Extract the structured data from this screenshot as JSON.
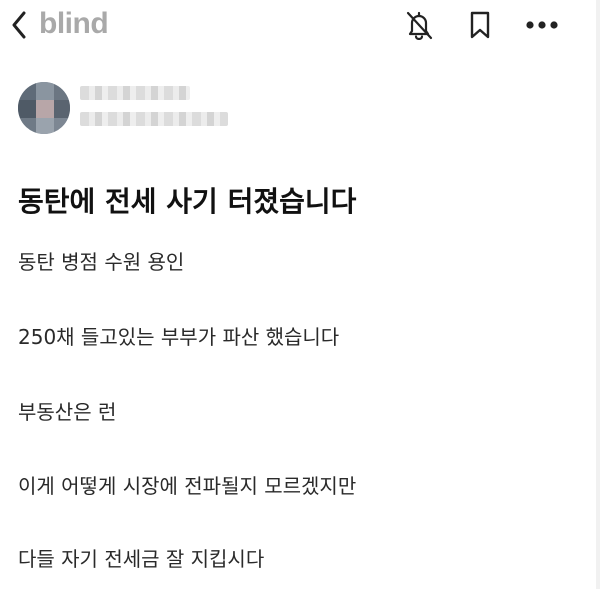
{
  "header": {
    "brand": "blind",
    "icons": {
      "back": "chevron-left-icon",
      "notifications": "bell-off-icon",
      "bookmark": "bookmark-icon",
      "more": "more-horizontal-icon"
    }
  },
  "post": {
    "title": "동탄에 전세 사기 터졌습니다",
    "paragraphs": [
      "동탄 병점 수원 용인",
      "250채 들고있는 부부가 파산 했습니다",
      "부동산은 런",
      "이게 어떻게 시장에 전파될지 모르겠지만",
      "다들 자기 전세금 잘 지킵시다"
    ]
  },
  "colors": {
    "brand": "#a9a9a9",
    "text": "#222222",
    "title": "#111111"
  }
}
